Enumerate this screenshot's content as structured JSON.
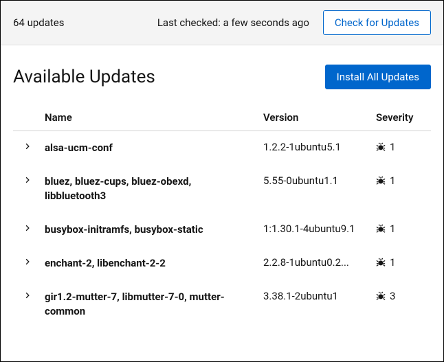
{
  "top": {
    "count_label": "64 updates",
    "last_checked": "Last checked: a few seconds ago",
    "check_button": "Check for Updates"
  },
  "main": {
    "heading": "Available Updates",
    "install_button": "Install All Updates"
  },
  "table": {
    "headers": {
      "name": "Name",
      "version": "Version",
      "severity": "Severity"
    },
    "rows": [
      {
        "name": "alsa-ucm-conf",
        "version": "1.2.2-1ubuntu5.1",
        "severity": "1"
      },
      {
        "name": "bluez, bluez-cups, bluez-obexd, libbluetooth3",
        "version": "5.55-0ubuntu1.1",
        "severity": "1"
      },
      {
        "name": "busybox-initramfs, busybox-static",
        "version": "1:1.30.1-4ubuntu9.1",
        "severity": "1"
      },
      {
        "name": "enchant-2, libenchant-2-2",
        "version": "2.2.8-1ubuntu0.2...",
        "severity": "1"
      },
      {
        "name": "gir1.2-mutter-7, libmutter-7-0, mutter-common",
        "version": "3.38.1-2ubuntu1",
        "severity": "3"
      }
    ]
  }
}
